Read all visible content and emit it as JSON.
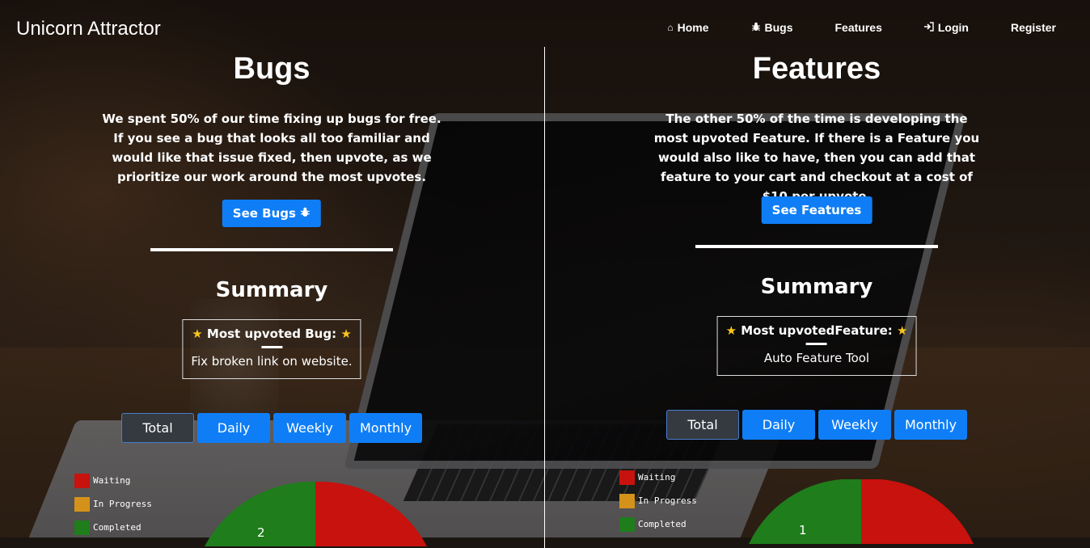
{
  "navbar": {
    "brand": "Unicorn Attractor",
    "items": [
      {
        "label": "Home",
        "icon": "home-icon"
      },
      {
        "label": "Bugs",
        "icon": "bug-icon"
      },
      {
        "label": "Features",
        "icon": ""
      },
      {
        "label": "Login",
        "icon": "login-icon"
      },
      {
        "label": "Register",
        "icon": ""
      }
    ]
  },
  "bugs": {
    "heading": "Bugs",
    "description": "We spent 50% of our time fixing up bugs for free. If you see a bug that looks all too familiar and would like that issue fixed, then upvote, as we prioritize our work around the most upvotes.",
    "button_label": "See Bugs",
    "summary_heading": "Summary",
    "most_upvoted_label": "Most upvoted Bug:",
    "most_upvoted_value": "Fix broken link on website.",
    "tabs": [
      "Total",
      "Daily",
      "Weekly",
      "Monthly"
    ],
    "active_tab": "Total",
    "chart_data": {
      "type": "pie",
      "categories": [
        "Waiting",
        "In Progress",
        "Completed"
      ],
      "colors": [
        "#c8120d",
        "#d4921a",
        "#1f7d1c"
      ],
      "visible_labels": [
        "2"
      ]
    }
  },
  "features": {
    "heading": "Features",
    "description": "The other 50% of the time is developing the most upvoted Feature. If there is a Feature you would also like to have, then you can add that feature to your cart and checkout at a cost of $10 per upvote.",
    "button_label": "See Features",
    "summary_heading": "Summary",
    "most_upvoted_label": "Most upvotedFeature:",
    "most_upvoted_value": "Auto Feature Tool",
    "tabs": [
      "Total",
      "Daily",
      "Weekly",
      "Monthly"
    ],
    "active_tab": "Total",
    "chart_data": {
      "type": "pie",
      "categories": [
        "Waiting",
        "In Progress",
        "Completed"
      ],
      "colors": [
        "#c8120d",
        "#d4921a",
        "#1f7d1c"
      ],
      "visible_labels": [
        "1"
      ]
    }
  },
  "colors": {
    "primary": "#0f7ef6",
    "active_tab": "#343a40",
    "star": "#f8c61a"
  }
}
